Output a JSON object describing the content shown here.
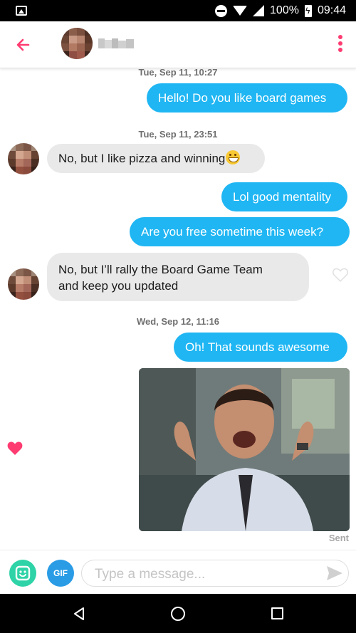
{
  "status_bar": {
    "battery": "100%",
    "time": "09:44"
  },
  "header": {
    "contact_name": ""
  },
  "messages": [
    {
      "timestamp": "Tue, Sep 11, 10:27"
    },
    {
      "text": "Hello! Do you like board games"
    },
    {
      "timestamp": "Tue, Sep 11, 23:51"
    },
    {
      "text": "No, but I like pizza and winning"
    },
    {
      "text": "Lol good mentality"
    },
    {
      "text": "Are you free sometime this week?"
    },
    {
      "text": "No, but I’ll rally the Board Game Team"
    },
    {
      "text": "and keep you updated"
    },
    {
      "timestamp": "Wed, Sep 12, 11:16"
    },
    {
      "text": "Oh! That sounds awesome"
    },
    {
      "status": "Sent"
    }
  ],
  "input_bar": {
    "gif_label": "GIF",
    "placeholder": "Type a message..."
  },
  "colors": {
    "accent": "#fe3c72",
    "outgoing_bubble": "#1fb6f3",
    "incoming_bubble": "#e9e9e9"
  },
  "icons": {
    "back": "back-arrow-icon",
    "menu": "more-vertical-icon",
    "like": "heart-icon",
    "sticker": "sticker-icon",
    "send": "send-icon"
  }
}
